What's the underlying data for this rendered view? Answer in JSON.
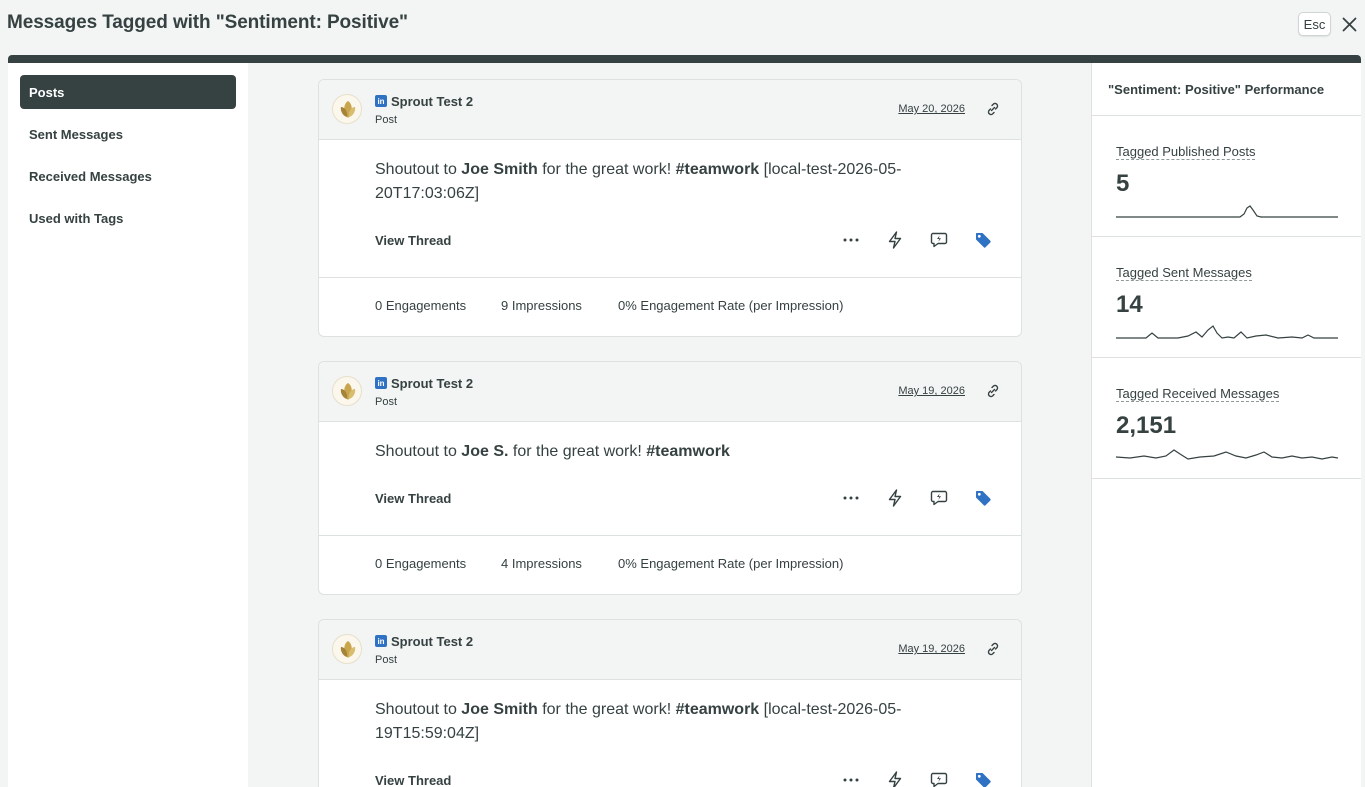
{
  "header": {
    "title": "Messages Tagged with \"Sentiment: Positive\"",
    "esc_label": "Esc"
  },
  "sidebar": {
    "items": [
      {
        "label": "Posts",
        "active": true
      },
      {
        "label": "Sent Messages",
        "active": false
      },
      {
        "label": "Received Messages",
        "active": false
      },
      {
        "label": "Used with Tags",
        "active": false
      }
    ]
  },
  "posts": [
    {
      "network_badge": "in",
      "account": "Sprout Test 2",
      "type": "Post",
      "date": "May 20, 2026",
      "text_before": "Shoutout to ",
      "mention": "Joe Smith",
      "text_middle": " for the great work! ",
      "hashtag": "#teamwork",
      "text_after": " [local-test-2026-05-20T17:03:06Z]",
      "view_thread": "View Thread",
      "engagements": "0 Engagements",
      "impressions": "9 Impressions",
      "engagement_rate": "0% Engagement Rate (per Impression)"
    },
    {
      "network_badge": "in",
      "account": "Sprout Test 2",
      "type": "Post",
      "date": "May 19, 2026",
      "text_before": "Shoutout to ",
      "mention": "Joe S.",
      "text_middle": " for the great work! ",
      "hashtag": "#teamwork",
      "text_after": "",
      "view_thread": "View Thread",
      "engagements": "0 Engagements",
      "impressions": "4 Impressions",
      "engagement_rate": "0% Engagement Rate (per Impression)"
    },
    {
      "network_badge": "in",
      "account": "Sprout Test 2",
      "type": "Post",
      "date": "May 19, 2026",
      "text_before": "Shoutout to ",
      "mention": "Joe Smith",
      "text_middle": " for the great work! ",
      "hashtag": "#teamwork",
      "text_after": " [local-test-2026-05-19T15:59:04Z]",
      "view_thread": "View Thread"
    }
  ],
  "performance": {
    "title": "\"Sentiment: Positive\" Performance",
    "stats": [
      {
        "label": "Tagged Published Posts",
        "value": "5"
      },
      {
        "label": "Tagged Sent Messages",
        "value": "14"
      },
      {
        "label": "Tagged Received Messages",
        "value": "2,151"
      }
    ]
  },
  "colors": {
    "brand_dark": "#364141",
    "tag_blue": "#2f72c4",
    "background": "#f3f4f4"
  }
}
